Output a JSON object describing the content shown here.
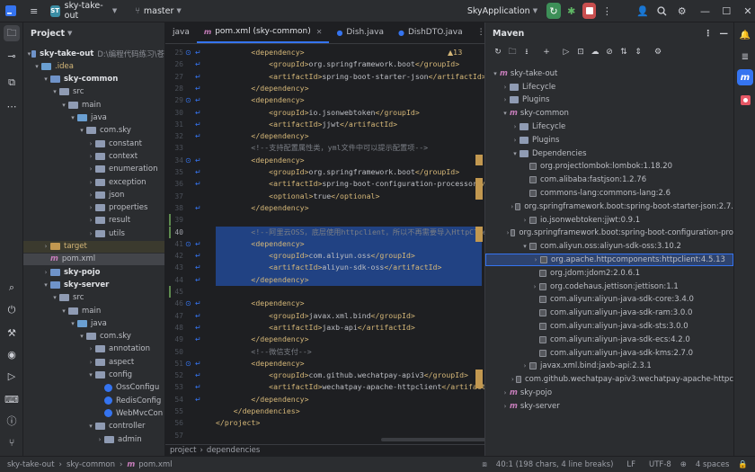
{
  "topbar": {
    "project_badge": "ST",
    "project_name": "sky-take-out",
    "branch": "master",
    "run_config": "SkyApplication"
  },
  "project_panel": {
    "title": "Project",
    "root": {
      "name": "sky-take-out",
      "path": "D:\\编程代码练习\\苍"
    },
    "items": [
      ".idea",
      "sky-common",
      "src",
      "main",
      "java",
      "com.sky",
      "constant",
      "context",
      "enumeration",
      "exception",
      "json",
      "properties",
      "result",
      "utils",
      "target",
      "pom.xml",
      "sky-pojo",
      "sky-server",
      "src",
      "main",
      "java",
      "com.sky",
      "annotation",
      "aspect",
      "config",
      "OssConfigu",
      "RedisConfig",
      "WebMvcCon",
      "controller",
      "admin"
    ]
  },
  "editor": {
    "tabs": [
      {
        "label": "java",
        "icon": ""
      },
      {
        "label": "pom.xml (sky-common)",
        "icon": "m",
        "active": true
      },
      {
        "label": "Dish.java",
        "icon": "java"
      },
      {
        "label": "DishDTO.java",
        "icon": "java"
      }
    ],
    "warning_count": "13",
    "lines": [
      {
        "n": "25",
        "parts": [
          [
            "tag",
            "        <dependency>"
          ]
        ]
      },
      {
        "n": "26",
        "parts": [
          [
            "tag",
            "            <groupId>"
          ],
          [
            "txt",
            "org.springframework.boot"
          ],
          [
            "tag",
            "</groupId>"
          ]
        ]
      },
      {
        "n": "27",
        "parts": [
          [
            "tag",
            "            <artifactId>"
          ],
          [
            "txt",
            "spring-boot-starter-json"
          ],
          [
            "tag",
            "</artifactId>"
          ]
        ]
      },
      {
        "n": "28",
        "parts": [
          [
            "tag",
            "        </dependency>"
          ]
        ]
      },
      {
        "n": "29",
        "parts": [
          [
            "tag",
            "        <dependency>"
          ]
        ]
      },
      {
        "n": "30",
        "parts": [
          [
            "tag",
            "            <groupId>"
          ],
          [
            "txt",
            "io.jsonwebtoken"
          ],
          [
            "tag",
            "</groupId>"
          ]
        ]
      },
      {
        "n": "31",
        "parts": [
          [
            "tag",
            "            <artifactId>"
          ],
          [
            "txt",
            "jjwt"
          ],
          [
            "tag",
            "</artifactId>"
          ]
        ]
      },
      {
        "n": "32",
        "parts": [
          [
            "tag",
            "        </dependency>"
          ]
        ]
      },
      {
        "n": "33",
        "parts": [
          [
            "cmt",
            "        <!--支持配置属性类，yml文件中可以提示配置项-->"
          ]
        ]
      },
      {
        "n": "34",
        "parts": [
          [
            "tag",
            "        <dependency>"
          ]
        ]
      },
      {
        "n": "35",
        "parts": [
          [
            "tag",
            "            <groupId>"
          ],
          [
            "txt",
            "org.springframework.boot"
          ],
          [
            "tag",
            "</groupId>"
          ]
        ]
      },
      {
        "n": "36",
        "parts": [
          [
            "tag",
            "            <artifactId>"
          ],
          [
            "txt",
            "spring-boot-configuration-processor"
          ],
          [
            "tag",
            "</ar"
          ]
        ]
      },
      {
        "n": "37",
        "parts": [
          [
            "tag",
            "            <optional>"
          ],
          [
            "txt",
            "true"
          ],
          [
            "tag",
            "</optional>"
          ]
        ]
      },
      {
        "n": "38",
        "parts": [
          [
            "tag",
            "        </dependency>"
          ]
        ]
      },
      {
        "n": "39",
        "parts": [
          [
            "txt",
            ""
          ]
        ]
      },
      {
        "n": "40",
        "parts": [
          [
            "cmt",
            "        <!--阿里云OSS，底层使用httpclient，所以不再需要导入HttpClient"
          ]
        ]
      },
      {
        "n": "41",
        "parts": [
          [
            "tag",
            "        <dependency>"
          ]
        ]
      },
      {
        "n": "42",
        "parts": [
          [
            "tag",
            "            <groupId>"
          ],
          [
            "txt",
            "com.aliyun.oss"
          ],
          [
            "tag",
            "</groupId>"
          ]
        ]
      },
      {
        "n": "43",
        "parts": [
          [
            "tag",
            "            <artifactId>"
          ],
          [
            "txt",
            "aliyun-sdk-oss"
          ],
          [
            "tag",
            "</artifactId>"
          ]
        ]
      },
      {
        "n": "44",
        "parts": [
          [
            "tag",
            "        </dependency>"
          ]
        ]
      },
      {
        "n": "45",
        "parts": [
          [
            "txt",
            ""
          ]
        ]
      },
      {
        "n": "46",
        "parts": [
          [
            "tag",
            "        <dependency>"
          ]
        ]
      },
      {
        "n": "47",
        "parts": [
          [
            "tag",
            "            <groupId>"
          ],
          [
            "txt",
            "javax.xml.bind"
          ],
          [
            "tag",
            "</groupId>"
          ]
        ]
      },
      {
        "n": "48",
        "parts": [
          [
            "tag",
            "            <artifactId>"
          ],
          [
            "txt",
            "jaxb-api"
          ],
          [
            "tag",
            "</artifactId>"
          ]
        ]
      },
      {
        "n": "49",
        "parts": [
          [
            "tag",
            "        </dependency>"
          ]
        ]
      },
      {
        "n": "50",
        "parts": [
          [
            "cmt",
            "        <!--微信支付-->"
          ]
        ]
      },
      {
        "n": "51",
        "parts": [
          [
            "tag",
            "        <dependency>"
          ]
        ]
      },
      {
        "n": "52",
        "parts": [
          [
            "tag",
            "            <groupId>"
          ],
          [
            "txt",
            "com.github.wechatpay-apiv3"
          ],
          [
            "tag",
            "</groupId>"
          ]
        ]
      },
      {
        "n": "53",
        "parts": [
          [
            "tag",
            "            <artifactId>"
          ],
          [
            "txt",
            "wechatpay-apache-httpclient"
          ],
          [
            "tag",
            "</artifactId>"
          ]
        ]
      },
      {
        "n": "54",
        "parts": [
          [
            "tag",
            "        </dependency>"
          ]
        ]
      },
      {
        "n": "55",
        "parts": [
          [
            "tag",
            "    </dependencies>"
          ]
        ]
      },
      {
        "n": "56",
        "parts": [
          [
            "tag",
            "</project>"
          ]
        ]
      },
      {
        "n": "57",
        "parts": [
          [
            "txt",
            ""
          ]
        ]
      }
    ],
    "breadcrumb": [
      "project",
      "dependencies"
    ]
  },
  "maven": {
    "title": "Maven",
    "items": [
      {
        "label": "sky-take-out",
        "kind": "module"
      },
      {
        "label": "Lifecycle",
        "kind": "folder"
      },
      {
        "label": "Plugins",
        "kind": "folder"
      },
      {
        "label": "sky-common",
        "kind": "module"
      },
      {
        "label": "Lifecycle",
        "kind": "folder"
      },
      {
        "label": "Plugins",
        "kind": "folder"
      },
      {
        "label": "Dependencies",
        "kind": "folder"
      },
      {
        "label": "org.projectlombok:lombok:1.18.20",
        "kind": "dep"
      },
      {
        "label": "com.alibaba:fastjson:1.2.76",
        "kind": "dep"
      },
      {
        "label": "commons-lang:commons-lang:2.6",
        "kind": "dep"
      },
      {
        "label": "org.springframework.boot:spring-boot-starter-json:2.7.",
        "kind": "dep"
      },
      {
        "label": "io.jsonwebtoken:jjwt:0.9.1",
        "kind": "dep"
      },
      {
        "label": "org.springframework.boot:spring-boot-configuration-pro",
        "kind": "dep"
      },
      {
        "label": "com.aliyun.oss:aliyun-sdk-oss:3.10.2",
        "kind": "dep"
      },
      {
        "label": "org.apache.httpcomponents:httpclient:4.5.13",
        "kind": "dep"
      },
      {
        "label": "org.jdom:jdom2:2.0.6.1",
        "kind": "dep"
      },
      {
        "label": "org.codehaus.jettison:jettison:1.1",
        "kind": "dep"
      },
      {
        "label": "com.aliyun:aliyun-java-sdk-core:3.4.0",
        "kind": "dep"
      },
      {
        "label": "com.aliyun:aliyun-java-sdk-ram:3.0.0",
        "kind": "dep"
      },
      {
        "label": "com.aliyun:aliyun-java-sdk-sts:3.0.0",
        "kind": "dep"
      },
      {
        "label": "com.aliyun:aliyun-java-sdk-ecs:4.2.0",
        "kind": "dep"
      },
      {
        "label": "com.aliyun:aliyun-java-sdk-kms:2.7.0",
        "kind": "dep"
      },
      {
        "label": "javax.xml.bind:jaxb-api:2.3.1",
        "kind": "dep"
      },
      {
        "label": "com.github.wechatpay-apiv3:wechatpay-apache-httpc",
        "kind": "dep"
      },
      {
        "label": "sky-pojo",
        "kind": "module"
      },
      {
        "label": "sky-server",
        "kind": "module"
      }
    ]
  },
  "status": {
    "path": [
      "sky-take-out",
      "sky-common",
      "pom.xml"
    ],
    "position": "40:1 (198 chars, 4 line breaks)",
    "line_sep": "LF",
    "encoding": "UTF-8",
    "indent": "4 spaces"
  }
}
